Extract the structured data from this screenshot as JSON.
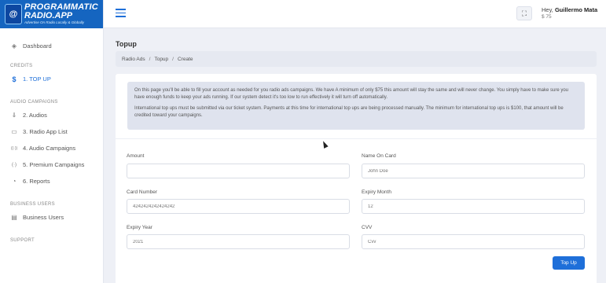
{
  "logo": {
    "line1": "PROGRAMMATIC",
    "line2": "RADIO.APP",
    "tagline": "Advertise On Radio Locally & Globally",
    "mark": "@"
  },
  "sidebar": {
    "dashboard": {
      "label": "Dashboard",
      "icon": "dashboard-icon",
      "glyph": "◈"
    },
    "credits_heading": "CREDITS",
    "topup": {
      "label": "1. TOP UP",
      "icon": "dollar-icon",
      "glyph": "$"
    },
    "audio_campaigns_heading": "AUDIO CAMPAIGNS",
    "items": [
      {
        "label": "2. Audios",
        "icon": "microphone-icon",
        "glyph": "⇓"
      },
      {
        "label": "3. Radio App List",
        "icon": "radio-icon",
        "glyph": "▭"
      },
      {
        "label": "4. Audio Campaigns",
        "icon": "broadcast-icon",
        "glyph": "((·))"
      },
      {
        "label": "5. Premium Campaigns",
        "icon": "premium-broadcast-icon",
        "glyph": "(·)"
      },
      {
        "label": "6. Reports",
        "icon": "pie-chart-icon",
        "glyph": "◔"
      }
    ],
    "business_heading": "BUSINESS USERS",
    "business_users": {
      "label": "Business Users",
      "icon": "document-icon",
      "glyph": "▤"
    },
    "support_heading": "SUPPORT"
  },
  "header": {
    "greeting": "Hey,",
    "user_name": "Guillermo Mata",
    "balance": "$ 75",
    "fullscreen_glyph": "⛶"
  },
  "page": {
    "title": "Topup",
    "breadcrumb": [
      "Radio Ads",
      "Topup",
      "Create"
    ]
  },
  "notice": {
    "p1": "On this page you'll be able to fill your account as needed for you radio ads campaigns. We have A minimum of only $75 this amount will stay the same and will never change. You simply have to make sure you have enough funds to keep your ads running. If our system detect it's too low to run effectively it will turn off automatically.",
    "p2": "International top ups must be submitted via our ticket system. Payments at this time for international top ups are being processed manually. The minimum for international top ups is $100, that amount will be credited toward your campaigns."
  },
  "form": {
    "amount": {
      "label": "Amount",
      "placeholder": ""
    },
    "name_on_card": {
      "label": "Name On Card",
      "placeholder": "John Doe"
    },
    "card_number": {
      "label": "Card Number",
      "placeholder": "4242424242424242"
    },
    "expiry_month": {
      "label": "Expiry Month",
      "placeholder": "12"
    },
    "expiry_year": {
      "label": "Expiry Year",
      "placeholder": "2021"
    },
    "cvv": {
      "label": "CVV",
      "placeholder": "Cvv"
    },
    "submit_label": "Top Up"
  },
  "colors": {
    "brand_blue": "#1565c0",
    "accent": "#1e6fd9"
  }
}
